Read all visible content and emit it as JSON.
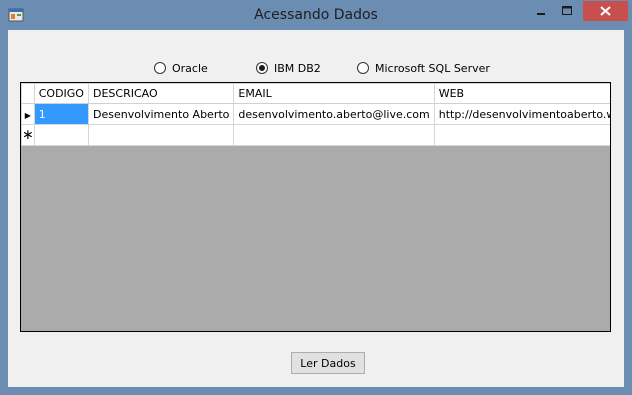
{
  "window": {
    "title": "Acessando Dados",
    "min_symbol": "—",
    "max_symbol": "□",
    "close_symbol": "✕"
  },
  "options": [
    {
      "label": "Oracle",
      "checked": false
    },
    {
      "label": "IBM DB2",
      "checked": true
    },
    {
      "label": "Microsoft SQL Server",
      "checked": false
    }
  ],
  "grid": {
    "columns": [
      "CODIGO",
      "DESCRICAO",
      "EMAIL",
      "WEB"
    ],
    "rows": [
      {
        "marker": "▶",
        "cells": [
          "1",
          "Desenvolvimento Aberto",
          "desenvolvimento.aberto@live.com",
          "http://desenvolvimentoaberto.wordp..."
        ]
      },
      {
        "marker": "∗",
        "cells": [
          "",
          "",
          "",
          ""
        ]
      }
    ]
  },
  "button": {
    "label": "Ler Dados"
  }
}
